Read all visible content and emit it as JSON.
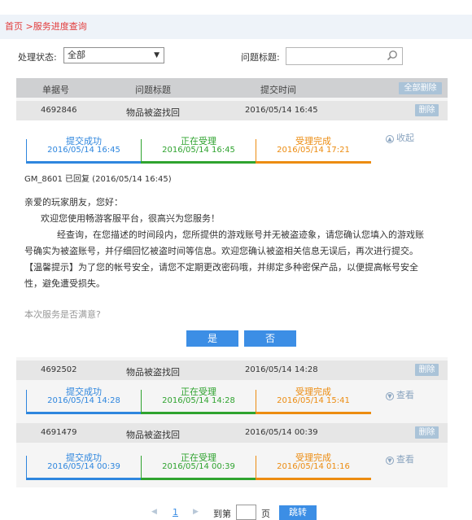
{
  "breadcrumb": {
    "home": "首页",
    "sep": ">",
    "current": "服务进度查询"
  },
  "filters": {
    "status_label": "处理状态:",
    "status_value": "全部",
    "title_label": "问题标题:",
    "search_value": ""
  },
  "table": {
    "headers": {
      "id": "单据号",
      "title": "问题标题",
      "time": "提交时间"
    },
    "delete_all": "全部删除",
    "delete": "删除"
  },
  "tickets": [
    {
      "id": "4692846",
      "title": "物品被盗找回",
      "time": "2016/05/14 16:45",
      "toggle": "收起",
      "steps": [
        {
          "label": "提交成功",
          "time": "2016/05/14 16:45"
        },
        {
          "label": "正在受理",
          "time": "2016/05/14 16:45"
        },
        {
          "label": "受理完成",
          "time": "2016/05/14 17:21"
        }
      ]
    },
    {
      "id": "4692502",
      "title": "物品被盗找回",
      "time": "2016/05/14 14:28",
      "toggle": "查看",
      "steps": [
        {
          "label": "提交成功",
          "time": "2016/05/14 14:28"
        },
        {
          "label": "正在受理",
          "time": "2016/05/14 14:28"
        },
        {
          "label": "受理完成",
          "time": "2016/05/14 15:41"
        }
      ]
    },
    {
      "id": "4691479",
      "title": "物品被盗找回",
      "time": "2016/05/14 00:39",
      "toggle": "查看",
      "steps": [
        {
          "label": "提交成功",
          "time": "2016/05/14 00:39"
        },
        {
          "label": "正在受理",
          "time": "2016/05/14 00:39"
        },
        {
          "label": "受理完成",
          "time": "2016/05/14 01:16"
        }
      ]
    }
  ],
  "reply": {
    "header": "GM_8601  已回复  (2016/05/14 16:45)",
    "greeting": "亲爱的玩家朋友，您好：",
    "welcome": "欢迎您使用畅游客服平台，很高兴为您服务！",
    "body": "经查询，在您描述的时间段内，您所提供的游戏账号并无被盗迹象，请您确认您填入的游戏账号确实为被盗账号，并仔细回忆被盗时间等信息。欢迎您确认被盗相关信息无误后，再次进行提交。",
    "tip": "【温馨提示】为了您的帐号安全，请您不定期更改密码哦，并绑定多种密保产品，以便提高帐号安全性，避免遭受损失。",
    "satisfaction_question": "本次服务是否满意?",
    "yes": "是",
    "no": "否"
  },
  "pager": {
    "current_page": "1",
    "goto_label": "到第",
    "page_unit": "页",
    "jump": "跳转"
  },
  "colors": {
    "accent": "#3c8ee5",
    "step1": "#2e86de",
    "step2": "#2fa32f",
    "step3": "#ec8c11",
    "breadcrumb": "#e23c3c"
  }
}
